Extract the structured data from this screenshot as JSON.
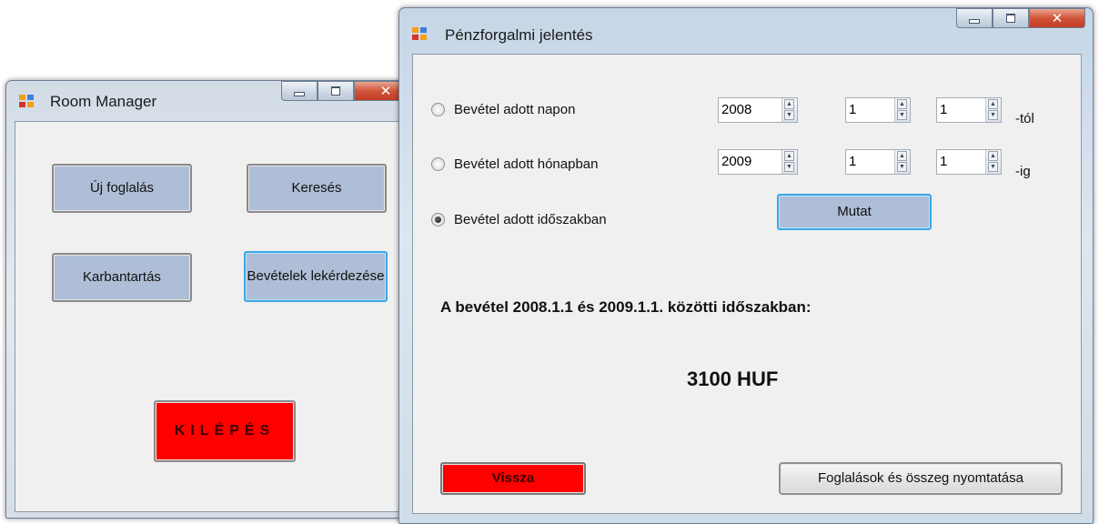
{
  "room_manager": {
    "title": "Room Manager",
    "new_booking": "Új foglalás",
    "search": "Keresés",
    "maintenance": "Karbantartás",
    "revenue_query": "Bevételek lekérdezése",
    "exit": "KILÉPÉS"
  },
  "report": {
    "title": "Pénzforgalmi jelentés",
    "options": [
      {
        "label": "Bevétel adott napon",
        "checked": false
      },
      {
        "label": "Bevétel adott hónapban",
        "checked": false
      },
      {
        "label": "Bevétel adott időszakban",
        "checked": true
      }
    ],
    "from": {
      "year": "2008",
      "month": "1",
      "day": "1",
      "suffix": "-tól"
    },
    "to": {
      "year": "2009",
      "month": "1",
      "day": "1",
      "suffix": "-ig"
    },
    "show_button": "Mutat",
    "result_text": "A bevétel 2008.1.1 és 2009.1.1. közötti időszakban:",
    "amount": "3100 HUF",
    "back_button": "Vissza",
    "print_button": "Foglalások és összeg nyomtatása"
  },
  "icons": {
    "app": "application-icon",
    "minimize": "minimize-icon",
    "maximize": "maximize-icon",
    "close": "close-icon",
    "spin_up": "arrow-up-icon",
    "spin_down": "arrow-down-icon"
  },
  "colors": {
    "exit_button": "#ff0000",
    "back_button": "#ff0000",
    "button_blue": "#aebed6",
    "focus_border": "#3aa7e6"
  }
}
